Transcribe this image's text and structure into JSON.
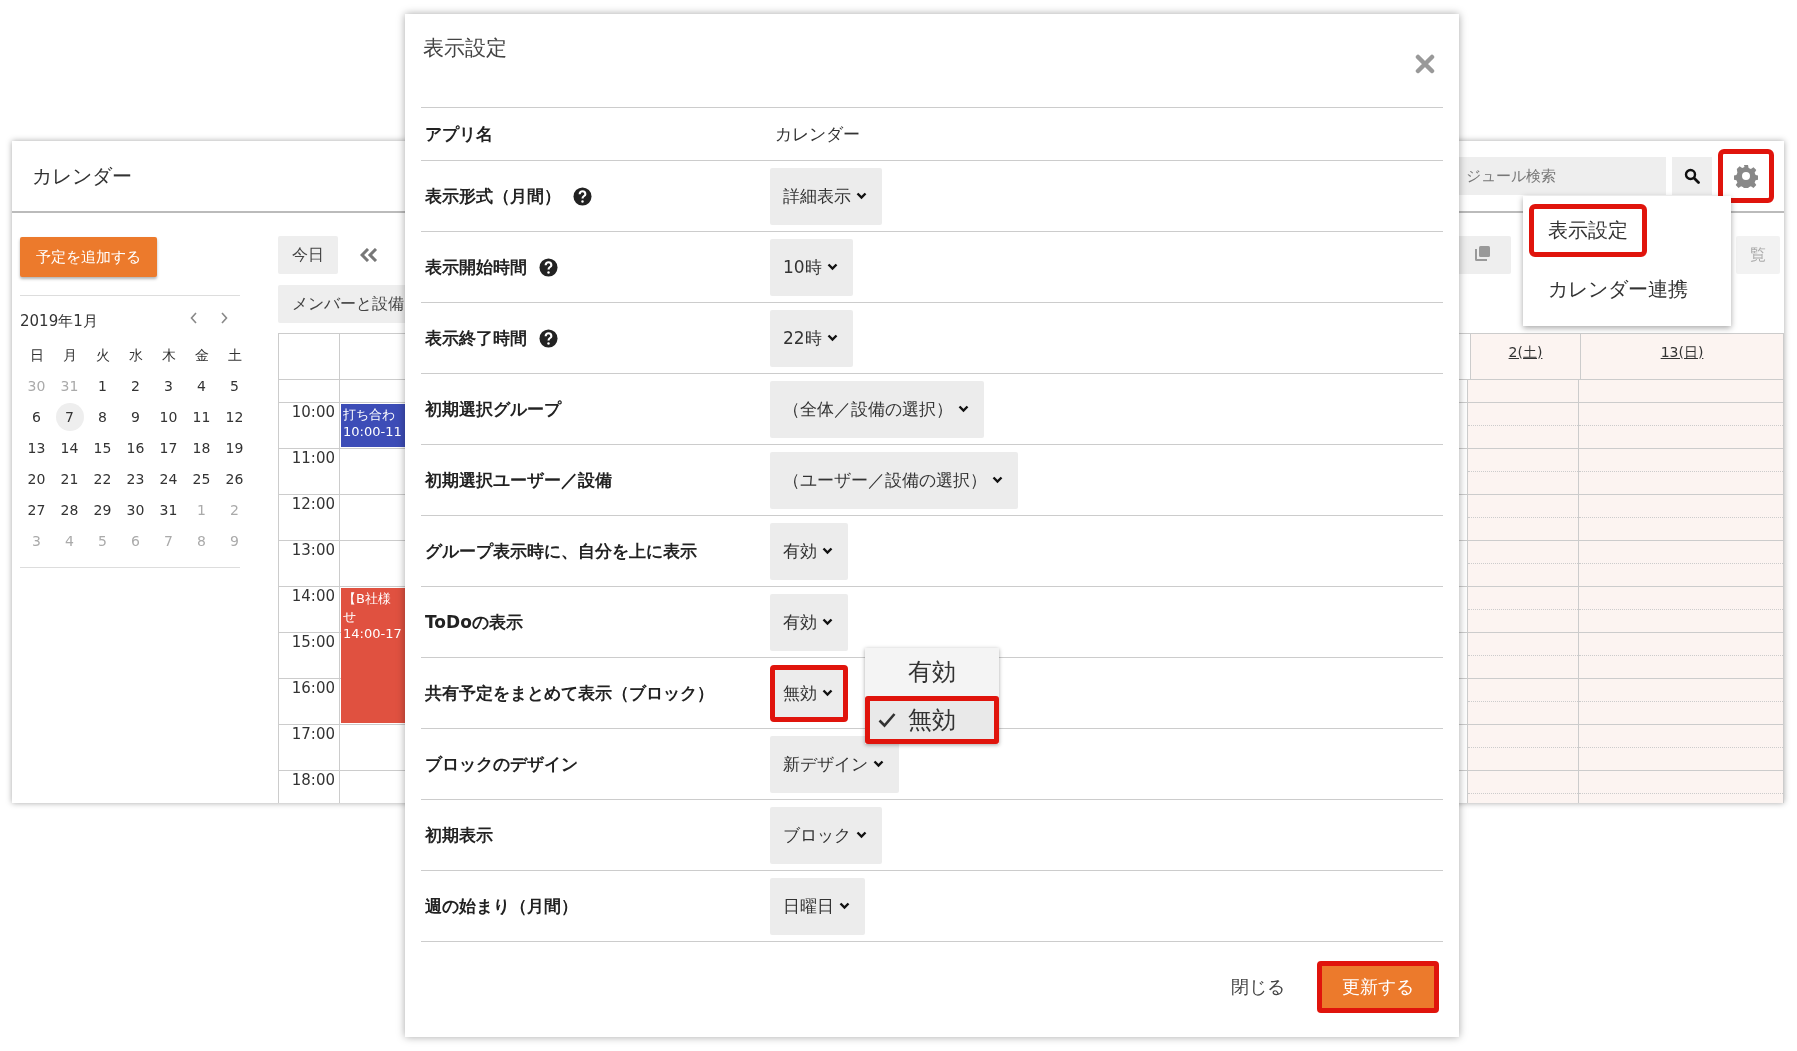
{
  "calendar_window": {
    "title": "カレンダー",
    "add_button": "予定を追加する",
    "today_button": "今日",
    "members_button": "メンバーと設備",
    "mini_calendar": {
      "month": "2019年1月",
      "weekdays": [
        "日",
        "月",
        "火",
        "水",
        "木",
        "金",
        "土"
      ],
      "weeks": [
        [
          {
            "day": "30",
            "other_month": true,
            "selected": false
          },
          {
            "day": "31",
            "other_month": true,
            "selected": false
          },
          {
            "day": "1",
            "other_month": false,
            "selected": false
          },
          {
            "day": "2",
            "other_month": false,
            "selected": false
          },
          {
            "day": "3",
            "other_month": false,
            "selected": false
          },
          {
            "day": "4",
            "other_month": false,
            "selected": false
          },
          {
            "day": "5",
            "other_month": false,
            "selected": false
          }
        ],
        [
          {
            "day": "6",
            "other_month": false,
            "selected": false
          },
          {
            "day": "7",
            "other_month": false,
            "selected": true
          },
          {
            "day": "8",
            "other_month": false,
            "selected": false
          },
          {
            "day": "9",
            "other_month": false,
            "selected": false
          },
          {
            "day": "10",
            "other_month": false,
            "selected": false
          },
          {
            "day": "11",
            "other_month": false,
            "selected": false
          },
          {
            "day": "12",
            "other_month": false,
            "selected": false
          }
        ],
        [
          {
            "day": "13",
            "other_month": false,
            "selected": false
          },
          {
            "day": "14",
            "other_month": false,
            "selected": false
          },
          {
            "day": "15",
            "other_month": false,
            "selected": false
          },
          {
            "day": "16",
            "other_month": false,
            "selected": false
          },
          {
            "day": "17",
            "other_month": false,
            "selected": false
          },
          {
            "day": "18",
            "other_month": false,
            "selected": false
          },
          {
            "day": "19",
            "other_month": false,
            "selected": false
          }
        ],
        [
          {
            "day": "20",
            "other_month": false,
            "selected": false
          },
          {
            "day": "21",
            "other_month": false,
            "selected": false
          },
          {
            "day": "22",
            "other_month": false,
            "selected": false
          },
          {
            "day": "23",
            "other_month": false,
            "selected": false
          },
          {
            "day": "24",
            "other_month": false,
            "selected": false
          },
          {
            "day": "25",
            "other_month": false,
            "selected": false
          },
          {
            "day": "26",
            "other_month": false,
            "selected": false
          }
        ],
        [
          {
            "day": "27",
            "other_month": false,
            "selected": false
          },
          {
            "day": "28",
            "other_month": false,
            "selected": false
          },
          {
            "day": "29",
            "other_month": false,
            "selected": false
          },
          {
            "day": "30",
            "other_month": false,
            "selected": false
          },
          {
            "day": "31",
            "other_month": false,
            "selected": false
          },
          {
            "day": "1",
            "other_month": true,
            "selected": false
          },
          {
            "day": "2",
            "other_month": true,
            "selected": false
          }
        ],
        [
          {
            "day": "3",
            "other_month": true,
            "selected": false
          },
          {
            "day": "4",
            "other_month": true,
            "selected": false
          },
          {
            "day": "5",
            "other_month": true,
            "selected": false
          },
          {
            "day": "6",
            "other_month": true,
            "selected": false
          },
          {
            "day": "7",
            "other_month": true,
            "selected": false
          },
          {
            "day": "8",
            "other_month": true,
            "selected": false
          },
          {
            "day": "9",
            "other_month": true,
            "selected": false
          }
        ]
      ]
    },
    "search": {
      "placeholder": "ジュール検索"
    },
    "settings_button": {
      "highlighted": true
    },
    "toolbar_right_label": "覧",
    "day_headers": [
      "2(土)",
      "13(日)"
    ],
    "hours": [
      {
        "label": "10:00",
        "event": {
          "kind": "short",
          "color": "#3d4db7",
          "lines": [
            "打ち合わ",
            "10:00-11"
          ]
        }
      },
      {
        "label": "11:00"
      },
      {
        "label": "12:00"
      },
      {
        "label": "13:00"
      },
      {
        "label": "14:00",
        "event": {
          "kind": "long",
          "color": "#e05140",
          "lines": [
            "【B社様",
            "せ",
            "14:00-17"
          ]
        }
      },
      {
        "label": "15:00"
      },
      {
        "label": "16:00"
      },
      {
        "label": "17:00"
      },
      {
        "label": "18:00"
      }
    ],
    "menu": [
      {
        "label": "表示設定",
        "highlighted": true
      },
      {
        "label": "カレンダー連携",
        "highlighted": false
      }
    ]
  },
  "dialog": {
    "title": "表示設定",
    "app_name": {
      "label": "アプリ名",
      "value": "カレンダー"
    },
    "settings": [
      {
        "label": "表示形式（月間）",
        "help": true,
        "value": "詳細表示",
        "highlighted": false
      },
      {
        "label": "表示開始時間",
        "help": true,
        "value": "10時",
        "highlighted": false
      },
      {
        "label": "表示終了時間",
        "help": true,
        "value": "22時",
        "highlighted": false
      },
      {
        "label": "初期選択グループ",
        "help": false,
        "value": "（全体／設備の選択）",
        "highlighted": false
      },
      {
        "label": "初期選択ユーザー／設備",
        "help": false,
        "value": "（ユーザー／設備の選択）",
        "highlighted": false
      },
      {
        "label": "グループ表示時に、自分を上に表示",
        "help": false,
        "value": "有効",
        "highlighted": false
      },
      {
        "label": "ToDoの表示",
        "help": false,
        "value": "有効",
        "highlighted": false
      },
      {
        "label": "共有予定をまとめて表示（ブロック）",
        "help": false,
        "value": "無効",
        "highlighted": true
      },
      {
        "label": "ブロックのデザイン",
        "help": false,
        "value": "新デザイン",
        "highlighted": false
      },
      {
        "label": "初期表示",
        "help": false,
        "value": "ブロック",
        "highlighted": false
      },
      {
        "label": "週の始まり（月間）",
        "help": false,
        "value": "日曜日",
        "highlighted": false
      }
    ],
    "open_dropdown": {
      "options": [
        {
          "label": "有効",
          "selected": false,
          "highlighted": false
        },
        {
          "label": "無効",
          "selected": true,
          "highlighted": true
        }
      ]
    },
    "close_button": "閉じる",
    "update_button": {
      "label": "更新する",
      "highlighted": true
    }
  }
}
